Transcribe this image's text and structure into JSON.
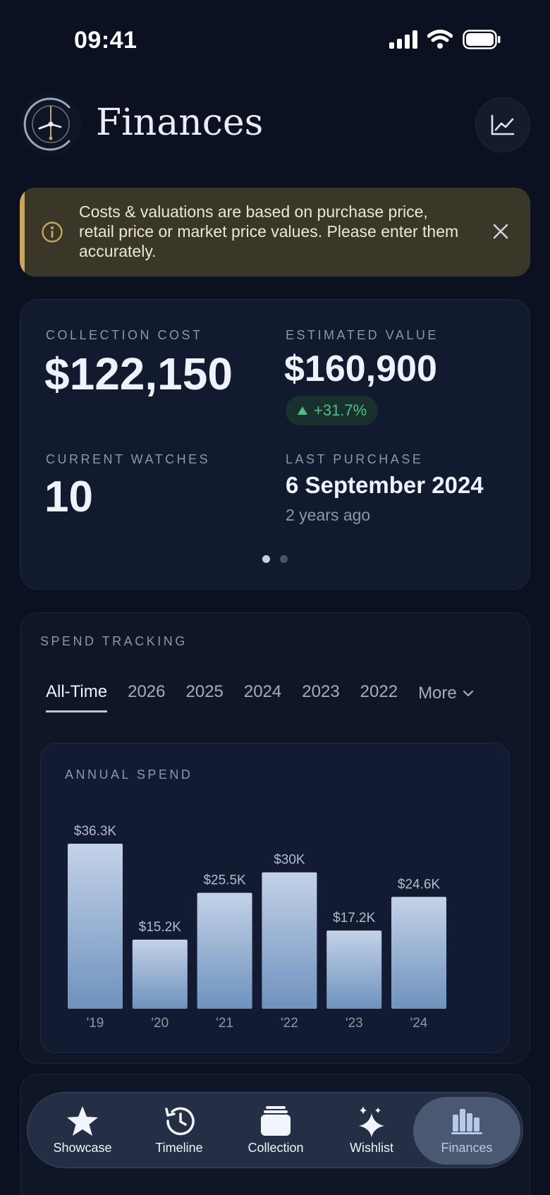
{
  "status_bar": {
    "time": "09:41"
  },
  "header": {
    "title": "Finances"
  },
  "notice": {
    "text": "Costs & valuations are based on purchase price, retail price or market price values. Please enter them accurately."
  },
  "summary": {
    "collection_cost_label": "COLLECTION COST",
    "collection_cost_value": "$122,150",
    "estimated_value_label": "ESTIMATED VALUE",
    "estimated_value_value": "$160,900",
    "growth_badge": "+31.7%",
    "current_watches_label": "CURRENT WATCHES",
    "current_watches_value": "10",
    "last_purchase_label": "LAST PURCHASE",
    "last_purchase_value": "6 September 2024",
    "last_purchase_ago": "2 years ago",
    "page_indicator": {
      "pages": 2,
      "current": 1
    }
  },
  "spend_tracking": {
    "label": "SPEND TRACKING",
    "tabs": [
      "All-Time",
      "2026",
      "2025",
      "2024",
      "2023",
      "2022"
    ],
    "active_tab": "All-Time",
    "more_label": "More"
  },
  "chart_data": {
    "type": "bar",
    "title": "ANNUAL SPEND",
    "categories": [
      "'19",
      "'20",
      "'21",
      "'22",
      "'23",
      "'24"
    ],
    "values": [
      36.3,
      15.2,
      25.5,
      30,
      17.2,
      24.6
    ],
    "value_labels": [
      "$36.3K",
      "$15.2K",
      "$25.5K",
      "$30K",
      "$17.2K",
      "$24.6K"
    ],
    "unit": "$K",
    "ylim": [
      0,
      36.3
    ],
    "grid": false,
    "bar_gradient": [
      "#c3d2e8",
      "#6e92bd"
    ]
  },
  "tab_bar": {
    "items": [
      {
        "label": "Showcase",
        "icon": "star-icon"
      },
      {
        "label": "Timeline",
        "icon": "history-clock-icon"
      },
      {
        "label": "Collection",
        "icon": "stack-icon"
      },
      {
        "label": "Wishlist",
        "icon": "sparkle-icon"
      },
      {
        "label": "Finances",
        "icon": "bar-chart-icon"
      }
    ],
    "active": "Finances"
  },
  "colors": {
    "background": "#0b1120",
    "card": "#111a2e",
    "notice_bg": "#3a3628",
    "notice_accent": "#c9a660",
    "positive": "#4fbf85",
    "muted_text": "#8d97ab"
  }
}
